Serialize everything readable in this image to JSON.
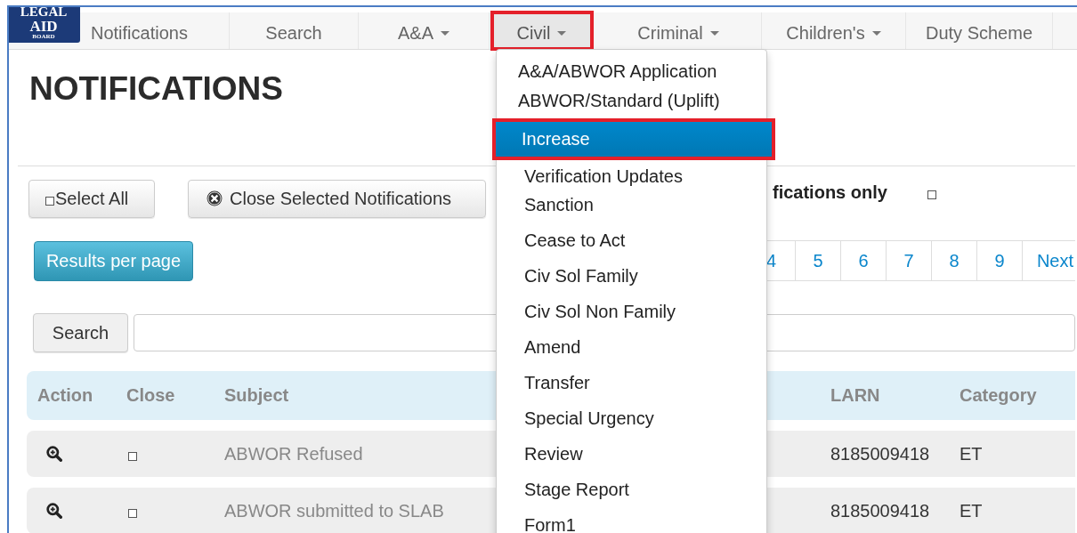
{
  "logo": {
    "lines": [
      "LEGAL",
      "AID",
      "BOARD"
    ]
  },
  "nav": [
    {
      "label": "Notifications",
      "dropdown": false,
      "selected": false,
      "highlighted": false
    },
    {
      "label": "Search",
      "dropdown": false,
      "selected": false,
      "highlighted": false
    },
    {
      "label": "A&A",
      "dropdown": true,
      "selected": false,
      "highlighted": false
    },
    {
      "label": "Civil",
      "dropdown": true,
      "selected": true,
      "highlighted": true
    },
    {
      "label": "Criminal",
      "dropdown": true,
      "selected": false,
      "highlighted": false
    },
    {
      "label": "Children's",
      "dropdown": true,
      "selected": false,
      "highlighted": false
    },
    {
      "label": "Duty Scheme",
      "dropdown": false,
      "selected": false,
      "highlighted": false
    }
  ],
  "page_title": "NOTIFICATIONS",
  "toolbar": {
    "select_all": {
      "label": "Select All",
      "checked": false
    },
    "close_selected": "Close Selected Notifications",
    "filter": {
      "label": "fications only",
      "checked": false
    }
  },
  "results_per_page": "Results per page",
  "pagination": [
    "4",
    "5",
    "6",
    "7",
    "8",
    "9",
    "Next"
  ],
  "search": {
    "button": "Search"
  },
  "table": {
    "columns": [
      "Action",
      "Close",
      "Subject",
      "LARN",
      "Category"
    ],
    "rows": [
      {
        "subject": "ABWOR Refused",
        "close": false,
        "larn": "8185009418",
        "category": "ET"
      },
      {
        "subject": "ABWOR submitted to SLAB",
        "close": false,
        "larn": "8185009418",
        "category": "ET"
      }
    ]
  },
  "civil_menu": [
    {
      "label": "A&A/ABWOR Application",
      "selected": false,
      "highlighted": false
    },
    {
      "label": "ABWOR/Standard (Uplift)",
      "selected": false,
      "highlighted": false
    },
    {
      "label": "Increase",
      "selected": true,
      "highlighted": true
    },
    {
      "label": "Verification Updates",
      "selected": false,
      "highlighted": false
    },
    {
      "label": "Sanction",
      "selected": false,
      "highlighted": false
    },
    {
      "label": "Cease to Act",
      "selected": false,
      "highlighted": false
    },
    {
      "label": "Civ Sol Family",
      "selected": false,
      "highlighted": false
    },
    {
      "label": "Civ Sol Non Family",
      "selected": false,
      "highlighted": false
    },
    {
      "label": "Amend",
      "selected": false,
      "highlighted": false
    },
    {
      "label": "Transfer",
      "selected": false,
      "highlighted": false
    },
    {
      "label": "Special Urgency",
      "selected": false,
      "highlighted": false
    },
    {
      "label": "Review",
      "selected": false,
      "highlighted": false
    },
    {
      "label": "Stage Report",
      "selected": false,
      "highlighted": false
    },
    {
      "label": "Form1",
      "selected": false,
      "highlighted": false
    }
  ]
}
